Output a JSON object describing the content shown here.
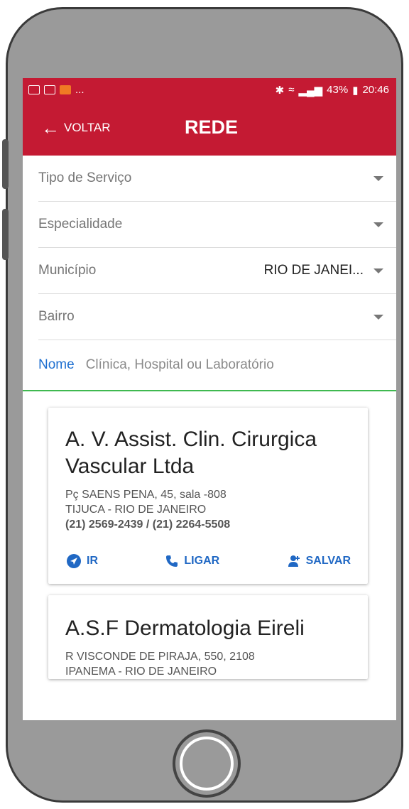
{
  "status_bar": {
    "battery": "43%",
    "time": "20:46",
    "ellipsis": "..."
  },
  "app_bar": {
    "back_label": "VOLTAR",
    "title": "REDE"
  },
  "filters": [
    {
      "label": "Tipo de Serviço",
      "value": ""
    },
    {
      "label": "Especialidade",
      "value": ""
    },
    {
      "label": "Município",
      "value": "RIO DE JANEI..."
    },
    {
      "label": "Bairro",
      "value": ""
    }
  ],
  "search": {
    "label": "Nome",
    "placeholder": "Clínica, Hospital ou Laboratório"
  },
  "results": [
    {
      "name": "A. V. Assist. Clin. Cirurgica Vascular Ltda",
      "address": "Pç SAENS PENA, 45, sala -808",
      "location": "TIJUCA - RIO DE JANEIRO",
      "phones": "(21) 2569-2439 / (21) 2264-5508"
    },
    {
      "name": "A.S.F Dermatologia Eireli",
      "address": "R VISCONDE DE PIRAJA, 550, 2108",
      "location": "IPANEMA - RIO DE JANEIRO",
      "phones": ""
    }
  ],
  "actions": {
    "go": "IR",
    "call": "LIGAR",
    "save": "SALVAR"
  },
  "colors": {
    "brand": "#c41a33",
    "link": "#2068c4",
    "focus_underline": "#3fb950"
  }
}
